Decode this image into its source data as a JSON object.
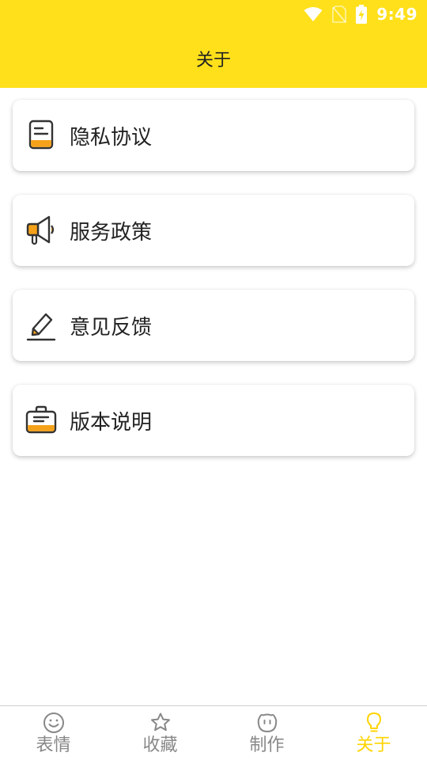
{
  "status_bar": {
    "time": "9:49",
    "icons": [
      "wifi-icon",
      "no-sim-icon",
      "battery-charging-icon"
    ]
  },
  "header": {
    "title": "关于"
  },
  "menu": {
    "items": [
      {
        "label": "隐私协议",
        "icon": "document-icon"
      },
      {
        "label": "服务政策",
        "icon": "megaphone-icon"
      },
      {
        "label": "意见反馈",
        "icon": "pencil-icon"
      },
      {
        "label": "版本说明",
        "icon": "briefcase-icon"
      }
    ]
  },
  "bottom_nav": {
    "items": [
      {
        "label": "表情",
        "icon": "smiley-icon",
        "active": false
      },
      {
        "label": "收藏",
        "icon": "star-icon",
        "active": false
      },
      {
        "label": "制作",
        "icon": "face-icon",
        "active": false
      },
      {
        "label": "关于",
        "icon": "lightbulb-icon",
        "active": true
      }
    ]
  },
  "colors": {
    "header": "#FFE01B",
    "accent_orange": "#F5A21A",
    "active_tab": "#FFD400",
    "inactive_tab": "#888888",
    "icon_stroke": "#333333"
  }
}
